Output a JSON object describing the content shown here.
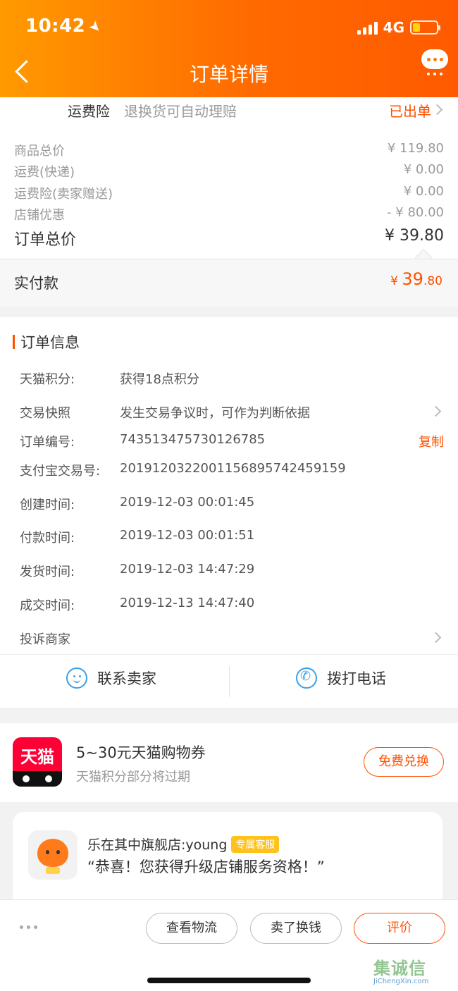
{
  "status_bar": {
    "time": "10:42",
    "network": "4G"
  },
  "nav": {
    "title": "订单详情"
  },
  "insurance": {
    "label": "运费险",
    "desc": "退换货可自动理赔",
    "status": "已出单"
  },
  "price_summary": [
    {
      "label": "商品总价",
      "value": "¥ 119.80"
    },
    {
      "label": "运费(快递)",
      "value": "¥ 0.00"
    },
    {
      "label": "运费险(卖家赠送)",
      "value": "¥ 0.00"
    },
    {
      "label": "店铺优惠",
      "value": "- ¥ 80.00"
    }
  ],
  "order_total": {
    "label": "订单总价",
    "value": "¥ 39.80"
  },
  "paid": {
    "label": "实付款",
    "symbol": "¥",
    "integer": "39",
    "decimal": ".80"
  },
  "order_info": {
    "heading": "订单信息",
    "rows": [
      {
        "key": "天猫积分:",
        "value": "获得18点积分"
      },
      {
        "key": "交易快照",
        "value": "发生交易争议时，可作为判断依据"
      },
      {
        "key": "订单编号:",
        "value": "743513475730126785",
        "action": "复制"
      },
      {
        "key": "支付宝交易号:",
        "value": "2019120322001156895742459159"
      },
      {
        "key": "创建时间:",
        "value": "2019-12-03 00:01:45"
      },
      {
        "key": "付款时间:",
        "value": "2019-12-03 00:01:51"
      },
      {
        "key": "发货时间:",
        "value": "2019-12-03 14:47:29"
      },
      {
        "key": "成交时间:",
        "value": "2019-12-13 14:47:40"
      },
      {
        "key": "投诉商家",
        "value": ""
      }
    ]
  },
  "contact": {
    "seller": "联系卖家",
    "phone": "拨打电话"
  },
  "coupon": {
    "logo_text": "天猫",
    "title": "5~30元天猫购物券",
    "subtitle": "天猫积分部分将过期",
    "button": "免费兑换"
  },
  "store": {
    "name": "乐在其中旗舰店:young",
    "badge": "专属客服",
    "message": "“恭喜！您获得升级店铺服务资格！”"
  },
  "actions": {
    "logistics": "查看物流",
    "resell": "卖了换钱",
    "review": "评价"
  },
  "watermark": {
    "zh": "集诚信",
    "en": "JiChengXin.com"
  },
  "colors": {
    "accent": "#ff5000",
    "header_start": "#ff9a00",
    "header_end": "#ff5a00",
    "link_blue": "#3aa0e6"
  }
}
